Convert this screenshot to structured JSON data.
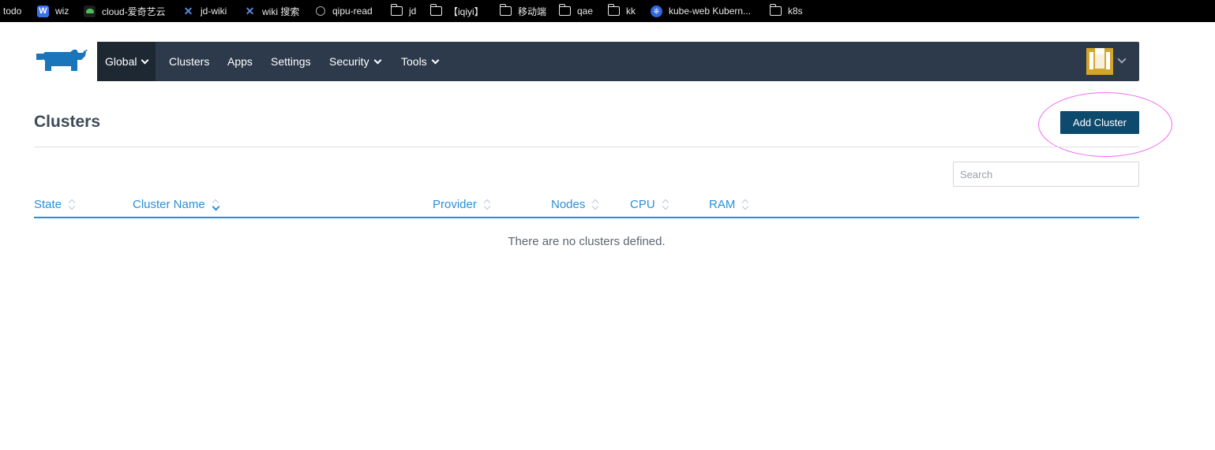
{
  "bookmarks": [
    {
      "label": "todo",
      "icon": "none"
    },
    {
      "label": "wiz",
      "icon": "wiz-icon",
      "icon_text": "W"
    },
    {
      "label": "cloud-爱奇艺云",
      "icon": "cloud-icon"
    },
    {
      "label": "jd-wiki",
      "icon": "confluence-icon"
    },
    {
      "label": "wiki 搜索",
      "icon": "confluence-icon"
    },
    {
      "label": "qipu-read",
      "icon": "read-icon"
    },
    {
      "label": "jd",
      "icon": "folder-icon"
    },
    {
      "label": "【iqiyi】",
      "icon": "folder-icon"
    },
    {
      "label": "移动端",
      "icon": "folder-icon"
    },
    {
      "label": "qae",
      "icon": "folder-icon"
    },
    {
      "label": "kk",
      "icon": "folder-icon"
    },
    {
      "label": "kube-web Kubern...",
      "icon": "kubernetes-icon"
    },
    {
      "label": "k8s",
      "icon": "folder-icon"
    }
  ],
  "nav": {
    "logo": "rancher-logo",
    "items": [
      {
        "label": "Global",
        "dropdown": true,
        "active": true
      },
      {
        "label": "Clusters",
        "dropdown": false
      },
      {
        "label": "Apps",
        "dropdown": false
      },
      {
        "label": "Settings",
        "dropdown": false
      },
      {
        "label": "Security",
        "dropdown": true
      },
      {
        "label": "Tools",
        "dropdown": true
      }
    ],
    "user_avatar": "user-avatar"
  },
  "page": {
    "title": "Clusters",
    "add_button": "Add Cluster"
  },
  "search": {
    "placeholder": "Search",
    "value": ""
  },
  "table": {
    "columns": [
      "State",
      "Cluster Name",
      "Provider",
      "Nodes",
      "CPU",
      "RAM"
    ],
    "sorted_column": "Cluster Name",
    "empty_message": "There are no clusters defined."
  },
  "colors": {
    "nav_bg": "#2c3a4b",
    "nav_active_bg": "#1e2833",
    "primary_button": "#0e4a6e",
    "link_blue": "#2a8fd6",
    "annotation_ring": "#f36af3"
  }
}
